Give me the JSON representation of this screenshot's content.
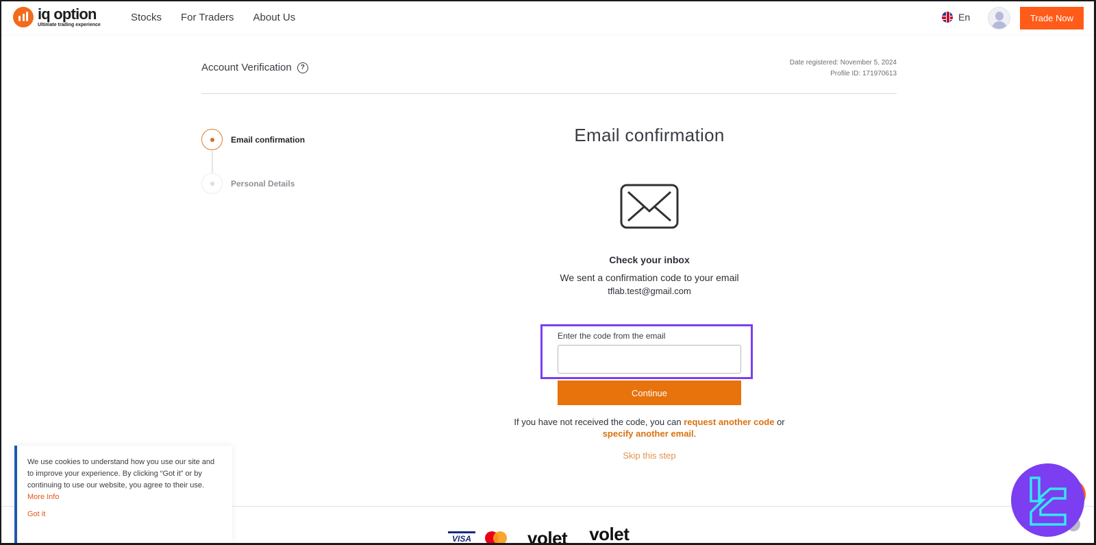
{
  "header": {
    "logo": {
      "name": "iq option",
      "tagline": "Ultimate trading experience"
    },
    "nav": [
      "Stocks",
      "For Traders",
      "About Us"
    ],
    "language": "En",
    "language_icon": "uk-flag-icon",
    "avatar_icon": "user-avatar-icon",
    "cta_label": "Trade Now"
  },
  "page": {
    "title": "Account Verification",
    "help_icon": "?",
    "date_registered": "Date registered: November 5, 2024",
    "profile_id": "Profile ID: 171970613"
  },
  "steps": [
    {
      "label": "Email confirmation",
      "state": "active"
    },
    {
      "label": "Personal Details",
      "state": "inactive"
    }
  ],
  "main": {
    "title": "Email confirmation",
    "icon": "envelope-icon",
    "inbox_title": "Check your inbox",
    "inbox_subtitle": "We sent a confirmation code to your email",
    "email": "tflab.test@gmail.com",
    "code_label": "Enter the code from the email",
    "code_value": "",
    "code_placeholder": "",
    "continue_label": "Continue",
    "resend_prefix": "If you have not received the code, you can ",
    "resend_link": "request another code",
    "resend_middle": " or ",
    "change_email_link": "specify another email",
    "resend_suffix": ".",
    "skip_label": "Skip this step"
  },
  "footer": {
    "payment_methods": [
      "VISA",
      "Mastercard",
      "volet",
      "volet"
    ]
  },
  "cookie": {
    "text": "We use cookies to understand how you use our site and to improve your experience. By clicking “Got it” or by continuing to use our website, you agree to their use. ",
    "more_info": "More Info",
    "accept_label": "Got it"
  },
  "colors": {
    "brand_orange": "#e8720c",
    "cta_orange": "#ff5c1a",
    "highlight_purple": "#7a3ff0",
    "cookie_accent": "#1d57b0"
  }
}
